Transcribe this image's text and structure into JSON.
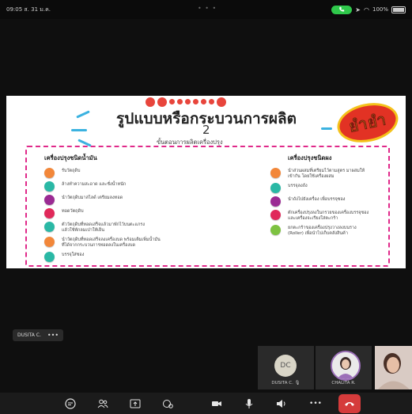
{
  "status": {
    "time_date": "09:05  ส. 31 ม.ค.",
    "center": "• • •",
    "battery": "100%"
  },
  "slide": {
    "title": "รูปแบบหรือกระบวนการผลิต",
    "number": "2",
    "subtitle": "ขั้นตอนการผลิตเครื่องปรุง",
    "logo_text": "ยำยำ",
    "left": {
      "heading": "เครื่องปรุงชนิดน้ำมัน",
      "steps": [
        {
          "text": "รับวัตถุดิบ",
          "color": "#f2873a"
        },
        {
          "text": "ล้างทำความสะอาด และชั่งน้ำหนัก",
          "color": "#2ab8a5"
        },
        {
          "text": "นำวัตถุดิบมาสไลด์ เตรียมลงทอด",
          "color": "#9b2a93"
        },
        {
          "text": "ทอดวัตถุดิบ",
          "color": "#e0295a"
        },
        {
          "text": "ตัววัตถุดิบที่ทอดเสร็จแล้วมาพักไว้บนตะแกรง\nแล้วใช้พักลมเป่าให้เย็น",
          "color": "#2ab8a5"
        },
        {
          "text": "นำวัตถุดิบที่ทอดเสร็จลงเครื่องบด พร้อมเติมเพิ่มน้ำมัน\nที่ได้จากกระบวนการทอดลงในเครื่องบด",
          "color": "#f2873a"
        },
        {
          "text": "บรรจุใส่ซอง",
          "color": "#2ab8a5"
        }
      ]
    },
    "right": {
      "heading": "เครื่องปรุงชนิดผง",
      "steps": [
        {
          "text": "นำส่วนผสมที่เตรียมไว้ตามสูตร มาผสมให้\nเข้ากัน โดยใช้เครื่องผสม",
          "color": "#f2873a"
        },
        {
          "text": "บรรจุลงถัง",
          "color": "#2ab8a5"
        },
        {
          "text": "นำถังไปยังเครื่อง เพื่อบรรจุซอง",
          "color": "#9b2a93"
        },
        {
          "text": "ตักเครื่องปรุงลงในกรวยของเครื่องบรรจุซอง\nและเครื่องจะเรียงใส่ตะกร้า",
          "color": "#e0295a"
        },
        {
          "text": "ยกตะกร้าของเครื่องปรุงวางลงบนราง\n(Roller) เพื่อนำไปเก็บคลังสินค้า",
          "color": "#7dc241"
        }
      ]
    }
  },
  "presenter_tag": {
    "name": "DUSITA C.",
    "more": "•••"
  },
  "participants": [
    {
      "initials": "DC",
      "name": "DUSITA C. 🎙"
    },
    {
      "initials": "",
      "name": "CHALITA R."
    }
  ],
  "toolbar": {
    "items": [
      "chat-icon",
      "participants-icon",
      "share-icon",
      "reactions-icon",
      "camera-icon",
      "microphone-icon",
      "speaker-icon",
      "more-icon",
      "end-call-icon"
    ],
    "more_label": "•••"
  },
  "colors": {
    "accent": "#e0298a",
    "end_call": "#d53b3b",
    "call_pill": "#2fc84b"
  }
}
